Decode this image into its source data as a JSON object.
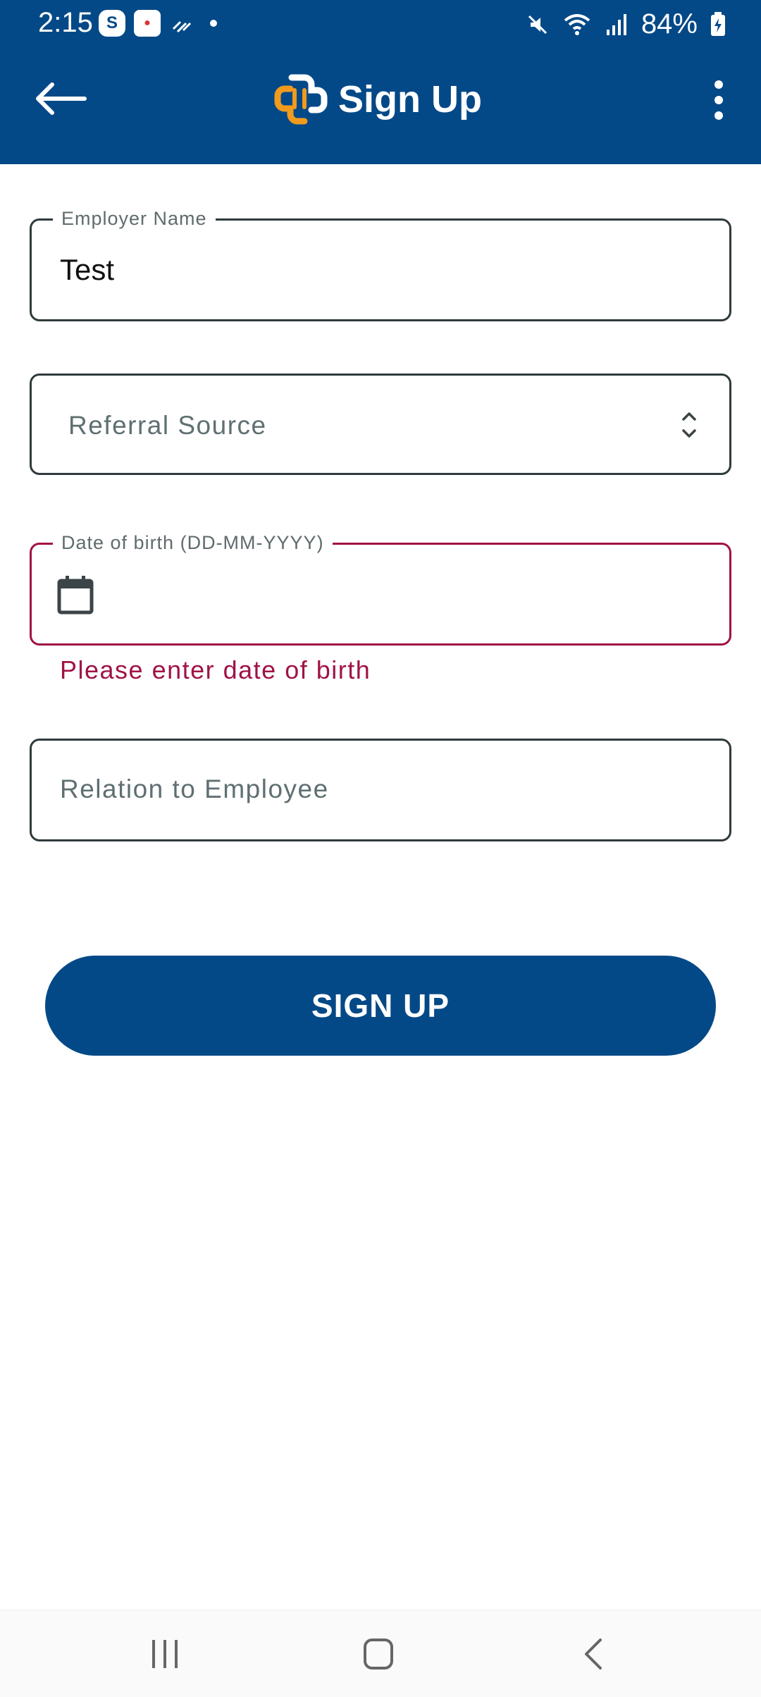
{
  "status_bar": {
    "time": "2:15",
    "battery": "84%",
    "notif_icons": [
      "skype-icon",
      "game-app-icon",
      "signal-app-icon",
      "dot-icon"
    ],
    "system_icons": [
      "mute-icon",
      "wifi-icon",
      "signal-bars-icon",
      "battery-icon"
    ]
  },
  "app_bar": {
    "title": "Sign Up",
    "back_icon": "arrow-left-icon",
    "menu_icon": "more-vertical-icon",
    "logo_icon": "cross-logo-icon",
    "colors": {
      "background": "#044987",
      "logo_blue": "#ffffff",
      "logo_orange": "#f29a1d"
    }
  },
  "form": {
    "employer_name": {
      "label": "Employer Name",
      "value": "Test"
    },
    "referral_source": {
      "placeholder": "Referral Source",
      "icon": "updown-chevron-icon"
    },
    "date_of_birth": {
      "label": "Date of birth (DD-MM-YYYY)",
      "value": "",
      "icon": "calendar-icon",
      "error": "Please enter date of birth",
      "error_color": "#a01346"
    },
    "relation": {
      "placeholder": "Relation to Employee"
    },
    "submit_label": "SIGN UP"
  },
  "nav_bar": {
    "icons": [
      "recents-icon",
      "home-icon",
      "back-icon"
    ]
  }
}
